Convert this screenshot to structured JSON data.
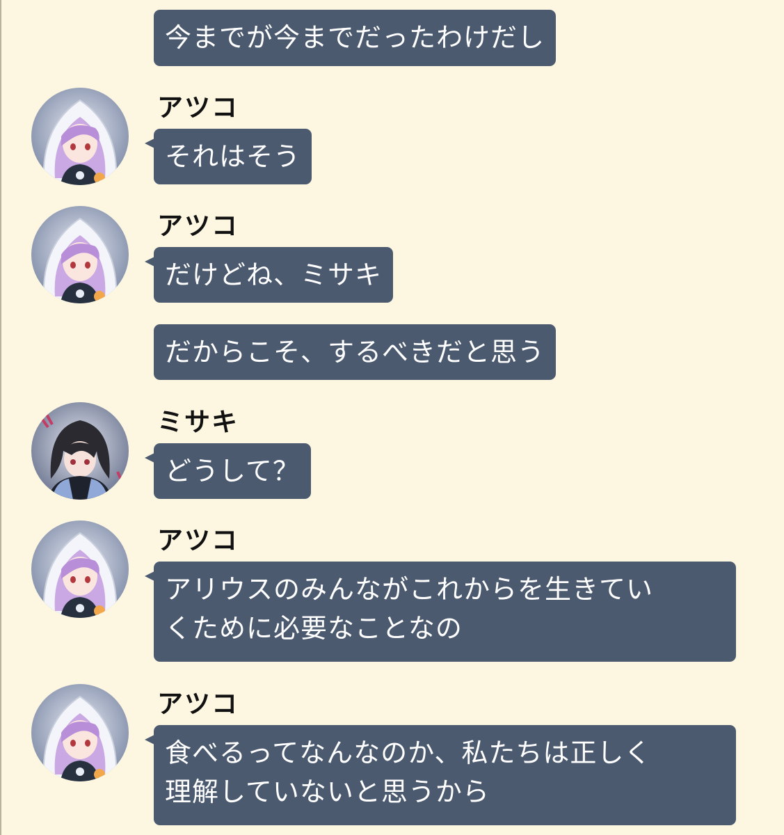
{
  "messages": [
    {
      "text": "今までが今までだったわけだし"
    },
    {
      "sender": "アツコ",
      "text": "それはそう"
    },
    {
      "sender": "アツコ",
      "text": "だけどね、ミサキ"
    },
    {
      "text": "だからこそ、するべきだと思う"
    },
    {
      "sender": "ミサキ",
      "text": "どうして？"
    },
    {
      "sender": "アツコ",
      "lines": [
        "アリウスのみんながこれからを生きてい",
        "くために必要なことなの"
      ]
    },
    {
      "sender": "アツコ",
      "lines": [
        "食べるってなんなのか、私たちは正しく",
        "理解していないと思うから"
      ]
    }
  ],
  "avatars": {
    "atsuko": "atsuko-avatar",
    "misaki": "misaki-avatar"
  },
  "colors": {
    "background": "#fdf7e1",
    "bubble": "#4c5a70",
    "bubble_text": "#ffffff",
    "name_text": "#111111"
  }
}
